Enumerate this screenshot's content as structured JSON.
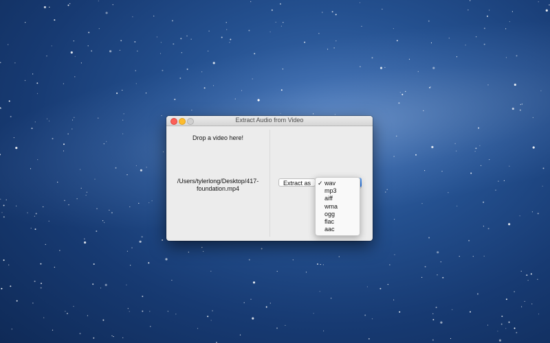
{
  "window": {
    "title": "Extract Audio from Video",
    "traffic_lights": [
      "close",
      "minimize",
      "zoom"
    ]
  },
  "left_panel": {
    "drop_label": "Drop a video here!",
    "file_path": "/Users/tylerlong/Desktop/417-foundation.mp4"
  },
  "right_panel": {
    "extract_button_label": "Extract as",
    "format_menu": {
      "selected": "wav",
      "check_mark": "✓",
      "options": [
        "wav",
        "mp3",
        "aiff",
        "wma",
        "ogg",
        "flac",
        "aac"
      ]
    }
  },
  "colors": {
    "close": "#fc5f57",
    "minimize": "#fdbc2e",
    "popup_accent": "#1a6ee6"
  }
}
